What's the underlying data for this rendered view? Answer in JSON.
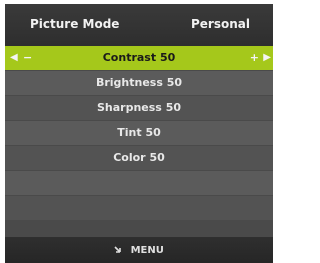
{
  "header": {
    "label": "Picture Mode",
    "value": "Personal"
  },
  "menu": {
    "items": [
      {
        "label": "Contrast",
        "value": "50",
        "selected": true
      },
      {
        "label": "Brightness",
        "value": "50",
        "selected": false
      },
      {
        "label": "Sharpness",
        "value": "50",
        "selected": false
      },
      {
        "label": "Tint",
        "value": "50",
        "selected": false
      },
      {
        "label": "Color",
        "value": "50",
        "selected": false
      }
    ],
    "adjust_decrease": "−",
    "adjust_increase": "+"
  },
  "footer": {
    "label": "MENU",
    "icon": "return-arrow-icon"
  },
  "colors": {
    "selected_bg": "#a5c81b",
    "panel_bg": "#4a4a4a"
  }
}
